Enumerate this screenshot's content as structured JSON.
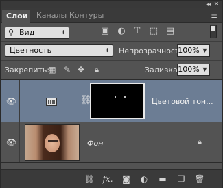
{
  "tabs": [
    {
      "label": "Слои",
      "active": true
    },
    {
      "label": "Каналы",
      "active": false
    },
    {
      "label": "Контуры",
      "active": false
    }
  ],
  "filter": {
    "kind_label": "Вид"
  },
  "blend": {
    "mode": "Цветность",
    "opacity_label": "Непрозрачность:",
    "opacity_value": "100%",
    "lock_label": "Закрепить:",
    "fill_label": "Заливка:",
    "fill_value": "100%"
  },
  "layers": [
    {
      "name": "Цветовой тон...",
      "selected": true,
      "type": "adjustment"
    },
    {
      "name": "Фон",
      "selected": false,
      "type": "background",
      "locked": true
    }
  ],
  "colors": {
    "panel_bg": "#535353",
    "selected_layer": "#6c7d94",
    "tabbar_bg": "#3a3a3a"
  },
  "icons": {
    "topbar": [
      "collapse-icon",
      "close-icon"
    ],
    "filter": [
      "image-filter-icon",
      "adjustment-filter-icon",
      "type-filter-icon",
      "shape-filter-icon",
      "smart-object-filter-icon",
      "filter-toggle"
    ],
    "lock": [
      "lock-pixels-icon",
      "lock-brush-icon",
      "lock-position-icon",
      "lock-all-icon"
    ],
    "bottom": [
      "link-icon",
      "fx-icon",
      "mask-icon",
      "adjustment-icon",
      "folder-icon",
      "new-layer-icon",
      "trash-icon"
    ]
  }
}
